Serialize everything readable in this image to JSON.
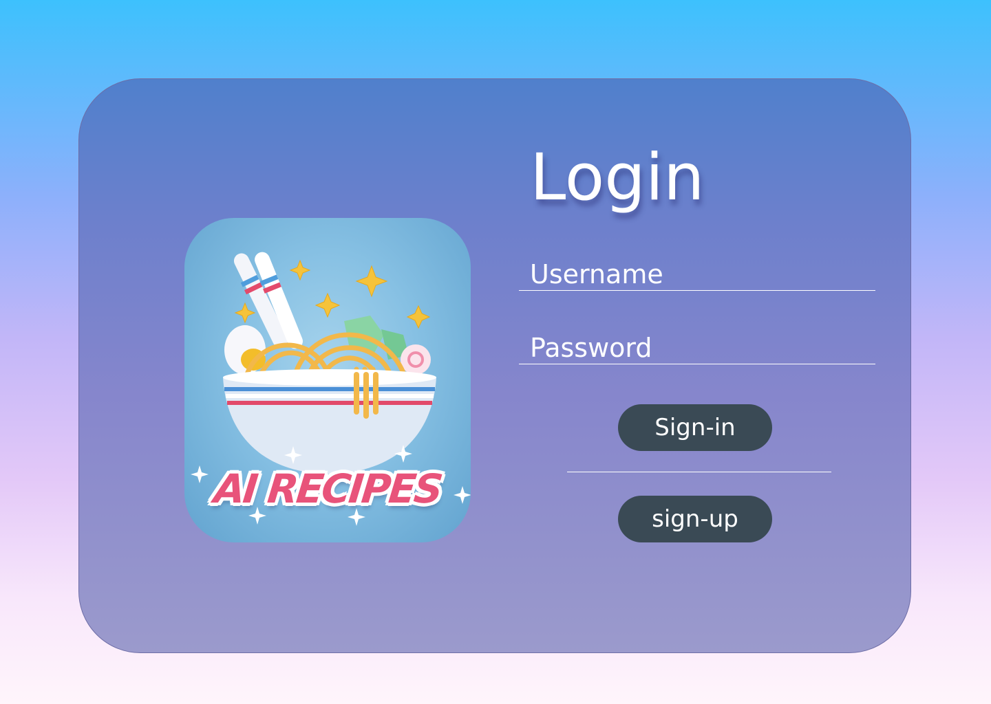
{
  "login": {
    "title": "Login",
    "username_placeholder": "Username",
    "password_placeholder": "Password",
    "signin_label": "Sign-in",
    "signup_label": "sign-up"
  },
  "logo": {
    "text": "AI RECIPES",
    "icon": "noodle-bowl-icon"
  },
  "colors": {
    "background_top": "#3dc1fd",
    "background_bottom": "#fff5fb",
    "card_top": "#5080cc",
    "card_bottom": "#9b9acc",
    "button": "#3a4a55",
    "logo_text": "#e8537a"
  }
}
